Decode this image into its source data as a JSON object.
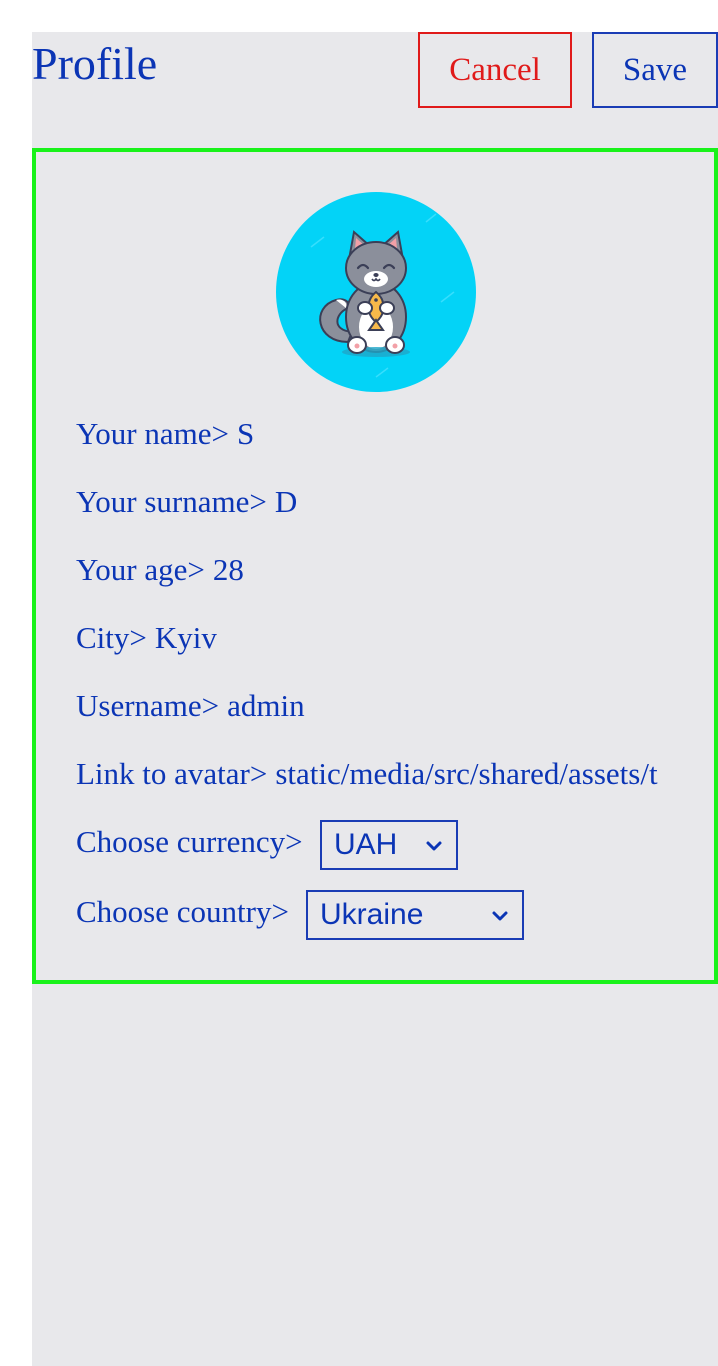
{
  "header": {
    "title": "Profile",
    "cancel_label": "Cancel",
    "save_label": "Save"
  },
  "profile": {
    "name_label": "Your name>",
    "name_value": "S",
    "surname_label": "Your surname>",
    "surname_value": "D",
    "age_label": "Your age>",
    "age_value": "28",
    "city_label": "City>",
    "city_value": "Kyiv",
    "username_label": "Username>",
    "username_value": "admin",
    "avatar_label": "Link to avatar>",
    "avatar_value": "static/media/src/shared/assets/t",
    "currency_label": "Choose currency>",
    "currency_value": "UAH",
    "country_label": "Choose country>",
    "country_value": "Ukraine"
  },
  "icons": {
    "avatar": "cat-holding-fish-avatar",
    "select_arrow": "chevron-down-icon"
  },
  "colors": {
    "text": "#0b35b5",
    "cancel": "#e01a1a",
    "card_border": "#19f21a",
    "background": "#e8e8eb",
    "avatar_bg": "#03d3f7"
  }
}
